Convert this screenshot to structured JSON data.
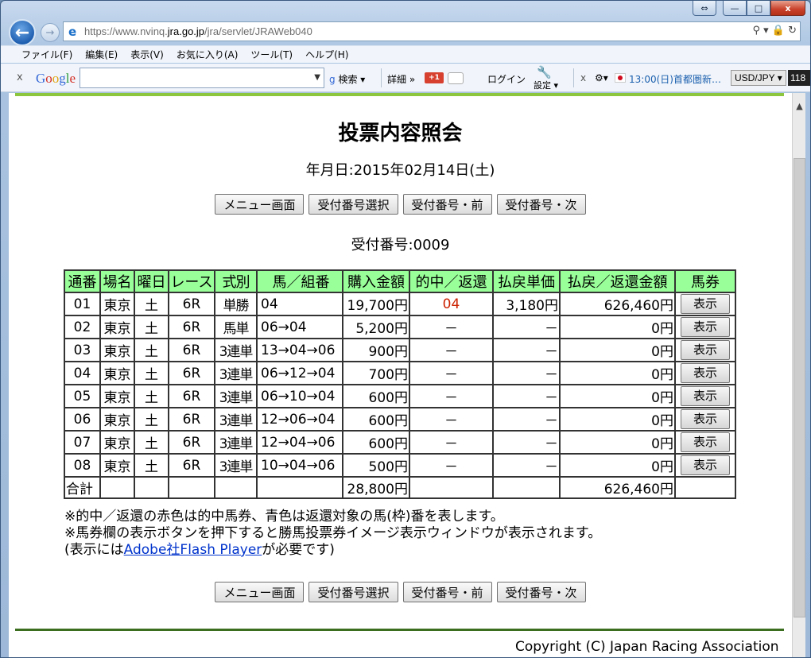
{
  "browser": {
    "url_prefix": "https://www.nvinq.",
    "url_domain": "jra.go.jp",
    "url_path": "/jra/servlet/JRAWeb040",
    "back_label": "←",
    "forward_label": "→",
    "addr_icons": "⚲ ▾ 🔒 ↻",
    "menu": [
      "ファイル(F)",
      "編集(E)",
      "表示(V)",
      "お気に入り(A)",
      "ツール(T)",
      "ヘルプ(H)"
    ],
    "window_restore": "⇔",
    "window_minimize": "—",
    "window_maximize": "□",
    "window_close": "x"
  },
  "toolbar": {
    "close": "x",
    "google": [
      "G",
      "o",
      "o",
      "g",
      "l",
      "e"
    ],
    "search_label": "検索 ▾",
    "details_label": "詳細 »",
    "gplus_label": "+1",
    "login_label": "ログイン",
    "settings_label": "設定 ▾",
    "close2": "x",
    "gear": "⚙▾",
    "news": "13:00(日)首都圏新…",
    "currency": "USD/JPY ▾",
    "currency_value": "118"
  },
  "page": {
    "title": "投票内容照会",
    "date_label": "年月日:2015年02月14日(土)",
    "receipt_label": "受付番号:0009",
    "buttons": {
      "menu": "メニュー画面",
      "select": "受付番号選択",
      "prev": "受付番号・前",
      "next": "受付番号・次"
    },
    "table": {
      "headers": [
        "通番",
        "場名",
        "曜日",
        "レース",
        "式別",
        "馬／組番",
        "購入金額",
        "的中／返還",
        "払戻単価",
        "払戻／返還金額",
        "馬券"
      ],
      "rows": [
        {
          "no": "01",
          "place": "東京",
          "day": "土",
          "race": "6R",
          "type": "単勝",
          "combo": "04",
          "amount": "19,700円",
          "hit": "04",
          "unit": "3,180円",
          "pay": "626,460円",
          "ticket": "表示"
        },
        {
          "no": "02",
          "place": "東京",
          "day": "土",
          "race": "6R",
          "type": "馬単",
          "combo": "06→04",
          "amount": "5,200円",
          "hit": "－",
          "unit": "－",
          "pay": "0円",
          "ticket": "表示"
        },
        {
          "no": "03",
          "place": "東京",
          "day": "土",
          "race": "6R",
          "type": "3連単",
          "combo": "13→04→06",
          "amount": "900円",
          "hit": "－",
          "unit": "－",
          "pay": "0円",
          "ticket": "表示"
        },
        {
          "no": "04",
          "place": "東京",
          "day": "土",
          "race": "6R",
          "type": "3連単",
          "combo": "06→12→04",
          "amount": "700円",
          "hit": "－",
          "unit": "－",
          "pay": "0円",
          "ticket": "表示"
        },
        {
          "no": "05",
          "place": "東京",
          "day": "土",
          "race": "6R",
          "type": "3連単",
          "combo": "06→10→04",
          "amount": "600円",
          "hit": "－",
          "unit": "－",
          "pay": "0円",
          "ticket": "表示"
        },
        {
          "no": "06",
          "place": "東京",
          "day": "土",
          "race": "6R",
          "type": "3連単",
          "combo": "12→06→04",
          "amount": "600円",
          "hit": "－",
          "unit": "－",
          "pay": "0円",
          "ticket": "表示"
        },
        {
          "no": "07",
          "place": "東京",
          "day": "土",
          "race": "6R",
          "type": "3連単",
          "combo": "12→04→06",
          "amount": "600円",
          "hit": "－",
          "unit": "－",
          "pay": "0円",
          "ticket": "表示"
        },
        {
          "no": "08",
          "place": "東京",
          "day": "土",
          "race": "6R",
          "type": "3連単",
          "combo": "10→04→06",
          "amount": "500円",
          "hit": "－",
          "unit": "－",
          "pay": "0円",
          "ticket": "表示"
        }
      ],
      "total_label": "合計",
      "total_amount": "28,800円",
      "total_pay": "626,460円"
    },
    "notes": {
      "line1": "※的中／返還の赤色は的中馬券、青色は返還対象の馬(枠)番を表します。",
      "line2": "※馬券欄の表示ボタンを押下すると勝馬投票券イメージ表示ウィンドウが表示されます。",
      "line3_pre": "(表示には",
      "line3_link": "Adobe社Flash Player",
      "line3_post": "が必要です)"
    },
    "copyright": "Copyright (C) Japan Racing Association"
  },
  "colors": {
    "header_green": "#99ff99",
    "accent_green": "#8cc63f",
    "hit_red": "#cc2200",
    "link_blue": "#0033cc"
  }
}
